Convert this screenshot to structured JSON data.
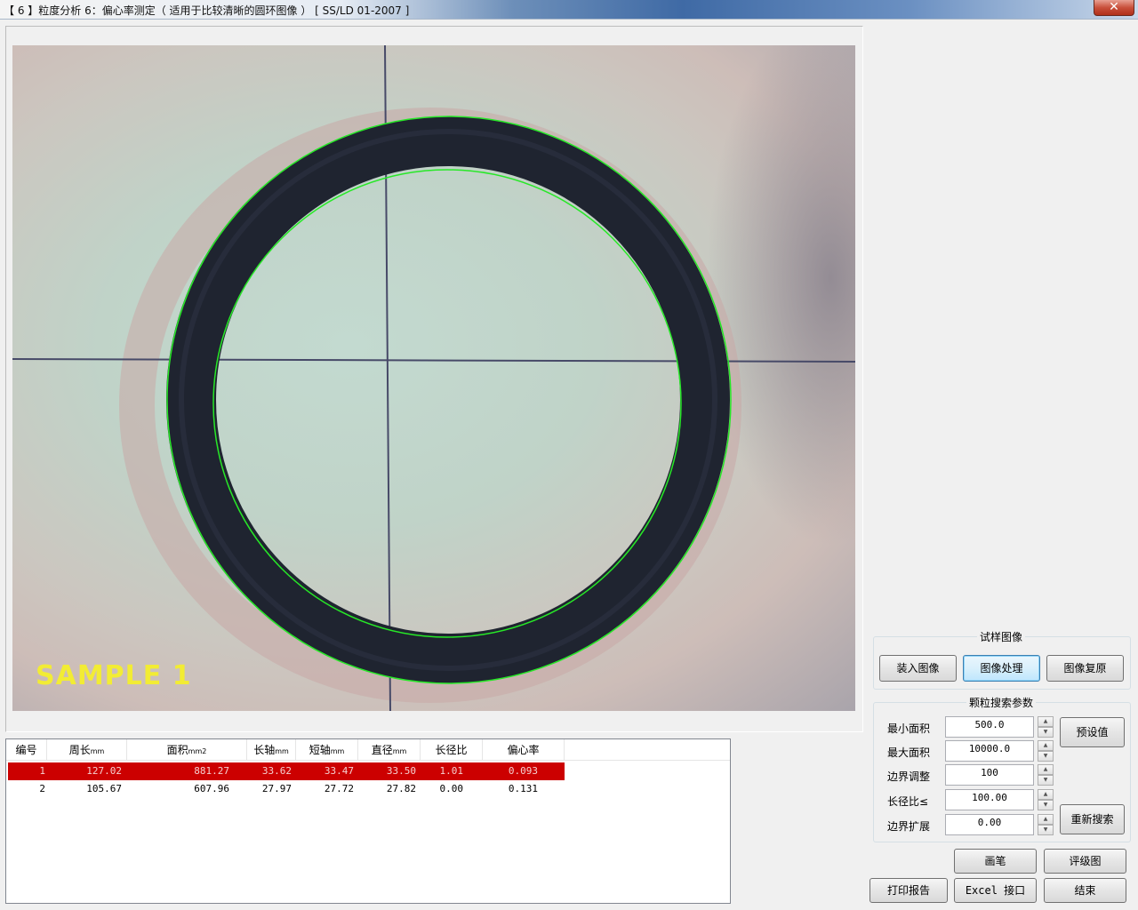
{
  "window": {
    "title": "【 6 】粒度分析 6：偏心率测定（ 适用于比较清晰的圆环图像 ）  [    SS/LD 01-2007   ]",
    "close_glyph": "✕"
  },
  "image": {
    "sample_label": "SAMPLE 1"
  },
  "table": {
    "headers": [
      {
        "text": "编号",
        "unit": ""
      },
      {
        "text": "周长",
        "unit": "mm"
      },
      {
        "text": "面积",
        "unit": "mm2"
      },
      {
        "text": "长轴",
        "unit": "mm"
      },
      {
        "text": "短轴",
        "unit": "mm"
      },
      {
        "text": "直径",
        "unit": "mm"
      },
      {
        "text": "长径比",
        "unit": ""
      },
      {
        "text": "偏心率",
        "unit": ""
      }
    ],
    "rows": [
      {
        "id": "1",
        "perimeter": "127.02",
        "area": "881.27",
        "major": "33.62",
        "minor": "33.47",
        "diameter": "33.50",
        "ratio": "1.01",
        "eccentricity": "0.093",
        "selected": true
      },
      {
        "id": "2",
        "perimeter": "105.67",
        "area": "607.96",
        "major": "27.97",
        "minor": "27.72",
        "diameter": "27.82",
        "ratio": "0.00",
        "eccentricity": "0.131",
        "selected": false
      }
    ]
  },
  "sample_panel": {
    "title": "试样图像",
    "load_label": "装入图像",
    "process_label": "图像处理",
    "restore_label": "图像复原"
  },
  "search_panel": {
    "title": "颗粒搜索参数",
    "params": [
      {
        "label": "最小面积",
        "value": "500.0"
      },
      {
        "label": "最大面积",
        "value": "10000.0"
      },
      {
        "label": "边界调整",
        "value": "100"
      },
      {
        "label": "长径比≤",
        "value": "100.00"
      },
      {
        "label": "边界扩展",
        "value": "0.00"
      }
    ],
    "preset_label": "预设值",
    "research_label": "重新搜索"
  },
  "bottom_buttons": {
    "pen_label": "画笔",
    "grade_label": "评级图",
    "print_label": "打印报告",
    "excel_label": "Excel 接口",
    "end_label": "结束"
  },
  "colors": {
    "contour": "#27e827",
    "selected_row": "#cc0000",
    "sample_label": "#f2ec34",
    "ring": "#1f2430"
  }
}
